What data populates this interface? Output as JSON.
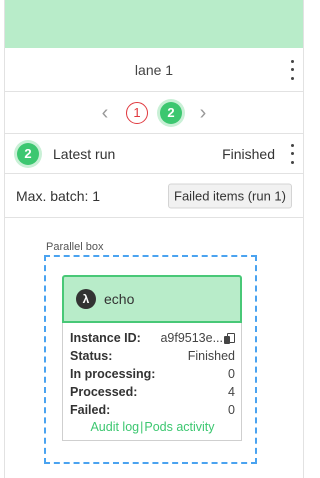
{
  "lane": {
    "title": "lane 1"
  },
  "pager": {
    "runs": [
      "1",
      "2"
    ],
    "prev_icon": "chevron-left-icon",
    "next_icon": "chevron-right-icon"
  },
  "latest": {
    "badge": "2",
    "label": "Latest run",
    "status": "Finished"
  },
  "batch": {
    "label": "Max. batch: 1",
    "failed_button": "Failed items (run 1)"
  },
  "parallel": {
    "label": "Parallel box"
  },
  "card": {
    "icon_text": "λ",
    "title": "echo",
    "fields": [
      {
        "key": "Instance ID:",
        "value": "a9f9513e..."
      },
      {
        "key": "Status:",
        "value": "Finished"
      },
      {
        "key": "In processing:",
        "value": "0"
      },
      {
        "key": "Processed:",
        "value": "4"
      },
      {
        "key": "Failed:",
        "value": "0"
      }
    ],
    "links": {
      "audit": "Audit log",
      "separator": "|",
      "pods": "Pods activity"
    }
  },
  "colors": {
    "accent": "#3cc770",
    "header_bg": "#b8ecc9",
    "failed": "#e0383e",
    "dashed_border": "#4aa3f0"
  }
}
